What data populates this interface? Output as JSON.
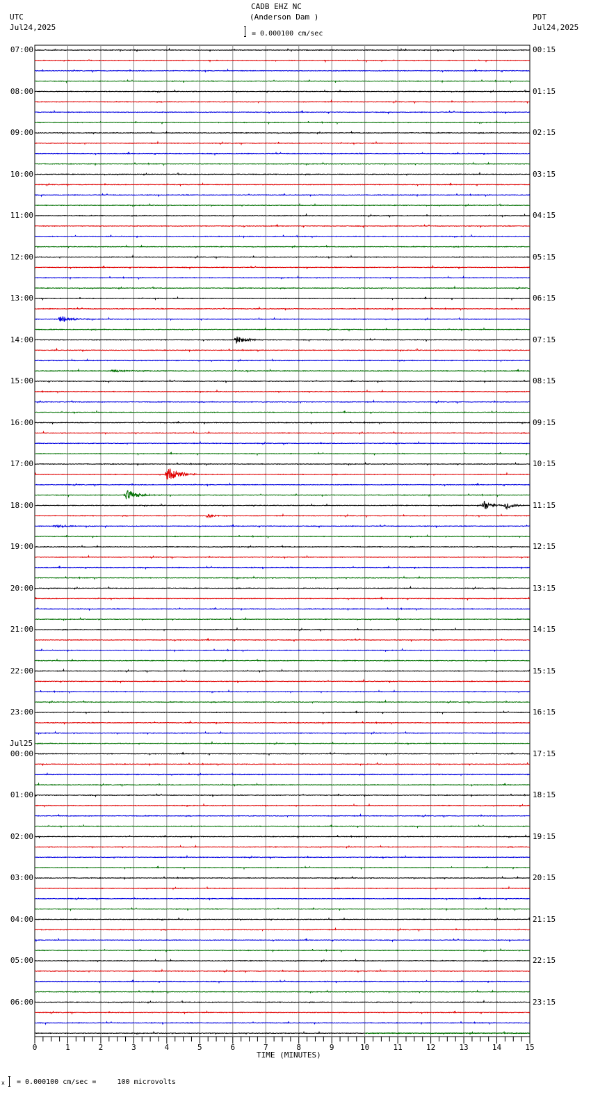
{
  "header": {
    "station": "CADB EHZ NC",
    "location": "(Anderson Dam )",
    "scale": "= 0.000100 cm/sec",
    "left_tz": "UTC",
    "left_date": "Jul24,2025",
    "right_tz": "PDT",
    "right_date": "Jul24,2025"
  },
  "footer": {
    "scale_note": "= 0.000100 cm/sec =     100 microvolts",
    "marker": "x"
  },
  "chart_data": {
    "type": "line",
    "title": "CADB EHZ NC (Anderson Dam )",
    "xlabel": "TIME (MINUTES)",
    "xlim": [
      0,
      15
    ],
    "x_ticks": [
      "0",
      "1",
      "2",
      "3",
      "4",
      "5",
      "6",
      "7",
      "8",
      "9",
      "10",
      "11",
      "12",
      "13",
      "14",
      "15"
    ],
    "rows_per_hour": 4,
    "row_count": 96,
    "colors": [
      "#000000",
      "#e00000",
      "#0000e0",
      "#007000"
    ],
    "utc_labels": [
      "07:00",
      "08:00",
      "09:00",
      "10:00",
      "11:00",
      "12:00",
      "13:00",
      "14:00",
      "15:00",
      "16:00",
      "17:00",
      "18:00",
      "19:00",
      "20:00",
      "21:00",
      "22:00",
      "23:00",
      "00:00",
      "01:00",
      "02:00",
      "03:00",
      "04:00",
      "05:00",
      "06:00"
    ],
    "date_change_label": "Jul25",
    "pdt_labels": [
      "00:15",
      "01:15",
      "02:15",
      "03:15",
      "04:15",
      "05:15",
      "06:15",
      "07:15",
      "08:15",
      "09:15",
      "10:15",
      "11:15",
      "12:15",
      "13:15",
      "14:15",
      "15:15",
      "16:15",
      "17:15",
      "18:15",
      "19:15",
      "20:15",
      "21:15",
      "22:15",
      "23:15"
    ],
    "events": [
      {
        "row": 26,
        "minute": 0.75,
        "duration": 0.9,
        "amplitude": 6
      },
      {
        "row": 28,
        "minute": 6.1,
        "duration": 0.8,
        "amplitude": 6
      },
      {
        "row": 31,
        "minute": 2.3,
        "duration": 1.6,
        "amplitude": 1.6
      },
      {
        "row": 41,
        "minute": 4.0,
        "duration": 0.9,
        "amplitude": 12
      },
      {
        "row": 43,
        "minute": 2.75,
        "duration": 0.9,
        "amplitude": 8
      },
      {
        "row": 44,
        "minute": 13.6,
        "duration": 0.6,
        "amplitude": 8
      },
      {
        "row": 44,
        "minute": 14.25,
        "duration": 0.6,
        "amplitude": 7
      },
      {
        "row": 45,
        "minute": 5.2,
        "duration": 0.8,
        "amplitude": 2.5
      },
      {
        "row": 46,
        "minute": 0.6,
        "duration": 1.2,
        "amplitude": 2
      }
    ],
    "last_row_data_until_minute": 10
  }
}
